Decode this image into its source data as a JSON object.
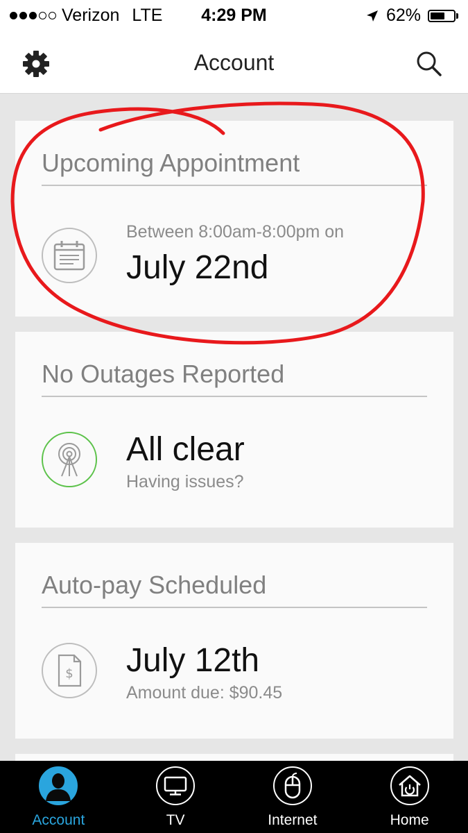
{
  "status_bar": {
    "carrier": "Verizon",
    "network": "LTE",
    "time": "4:29 PM",
    "battery": "62%",
    "battery_level": 0.62
  },
  "nav": {
    "title": "Account",
    "settings_icon": "gear-icon",
    "search_icon": "search-icon"
  },
  "cards": {
    "appointment": {
      "title": "Upcoming Appointment",
      "subtitle": "Between 8:00am-8:00pm on",
      "value": "July 22nd",
      "icon": "calendar-icon"
    },
    "outages": {
      "title": "No Outages Reported",
      "value": "All clear",
      "subtitle": "Having issues?",
      "icon": "tower-icon"
    },
    "autopay": {
      "title": "Auto-pay Scheduled",
      "value": "July 12th",
      "subtitle": "Amount due: $90.45",
      "icon": "bill-icon"
    }
  },
  "tabs": [
    {
      "label": "Account",
      "icon": "account-icon",
      "active": true
    },
    {
      "label": "TV",
      "icon": "tv-icon",
      "active": false
    },
    {
      "label": "Internet",
      "icon": "mouse-icon",
      "active": false
    },
    {
      "label": "Home",
      "icon": "home-icon",
      "active": false
    }
  ],
  "colors": {
    "accent": "#2aa5de",
    "annotation": "#e8191c",
    "status_ok": "#5cc24a"
  }
}
